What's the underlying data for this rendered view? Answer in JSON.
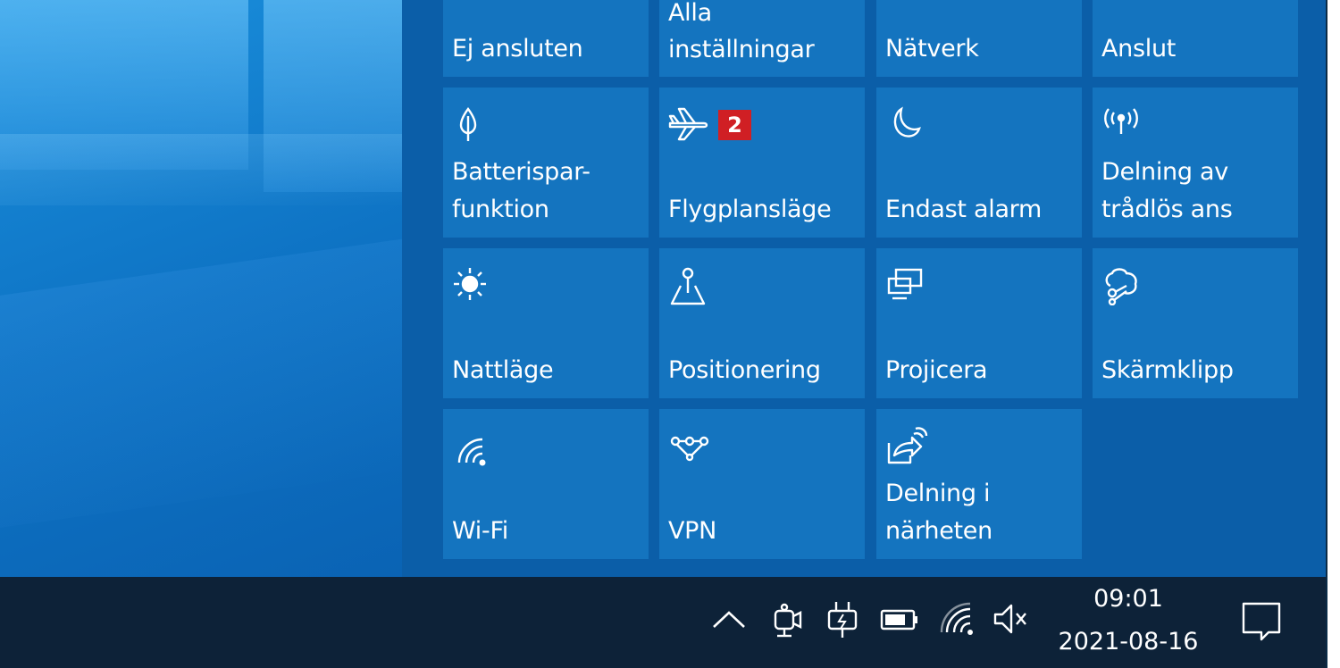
{
  "tiles": [
    {
      "label": "Ej ansluten",
      "icon": "bluetooth-icon",
      "state": "on"
    },
    {
      "label": "Alla\ninställningar",
      "icon": "settings-icon",
      "state": "on"
    },
    {
      "label": "Nätverk",
      "icon": "network-icon",
      "state": "on"
    },
    {
      "label": "Anslut",
      "icon": "connect-icon",
      "state": "on"
    },
    {
      "label": "Batterispar-\nfunktion",
      "icon": "battery-saver-icon",
      "state": "on"
    },
    {
      "label": "Flygplansläge",
      "icon": "airplane-icon",
      "state": "on",
      "badge": "2"
    },
    {
      "label": "Endast alarm",
      "icon": "moon-icon",
      "state": "on"
    },
    {
      "label": "Delning av\ntrådlös ans",
      "icon": "hotspot-icon",
      "state": "on"
    },
    {
      "label": "Nattläge",
      "icon": "brightness-icon",
      "state": "on"
    },
    {
      "label": "Positionering",
      "icon": "location-icon",
      "state": "on"
    },
    {
      "label": "Projicera",
      "icon": "project-icon",
      "state": "on"
    },
    {
      "label": "Skärmklipp",
      "icon": "snip-icon",
      "state": "on"
    },
    {
      "label": "Wi-Fi",
      "icon": "wifi-icon",
      "state": "on"
    },
    {
      "label": "VPN",
      "icon": "vpn-icon",
      "state": "on"
    },
    {
      "label": "Delning i\nnärheten",
      "icon": "nearby-share-icon",
      "state": "on"
    }
  ],
  "taskbar": {
    "tray_icons": [
      "chevron-up-icon",
      "meet-now-icon",
      "power-plug-icon",
      "battery-icon",
      "wifi-icon",
      "volume-muted-icon"
    ],
    "clock": {
      "time": "09:01",
      "date": "2021-08-16"
    },
    "notification_icon": "notification-icon"
  },
  "colors": {
    "tile": "#1474bf",
    "panel": "#0b5ea8",
    "taskbar": "#0d2238",
    "badge": "#d01f24"
  }
}
